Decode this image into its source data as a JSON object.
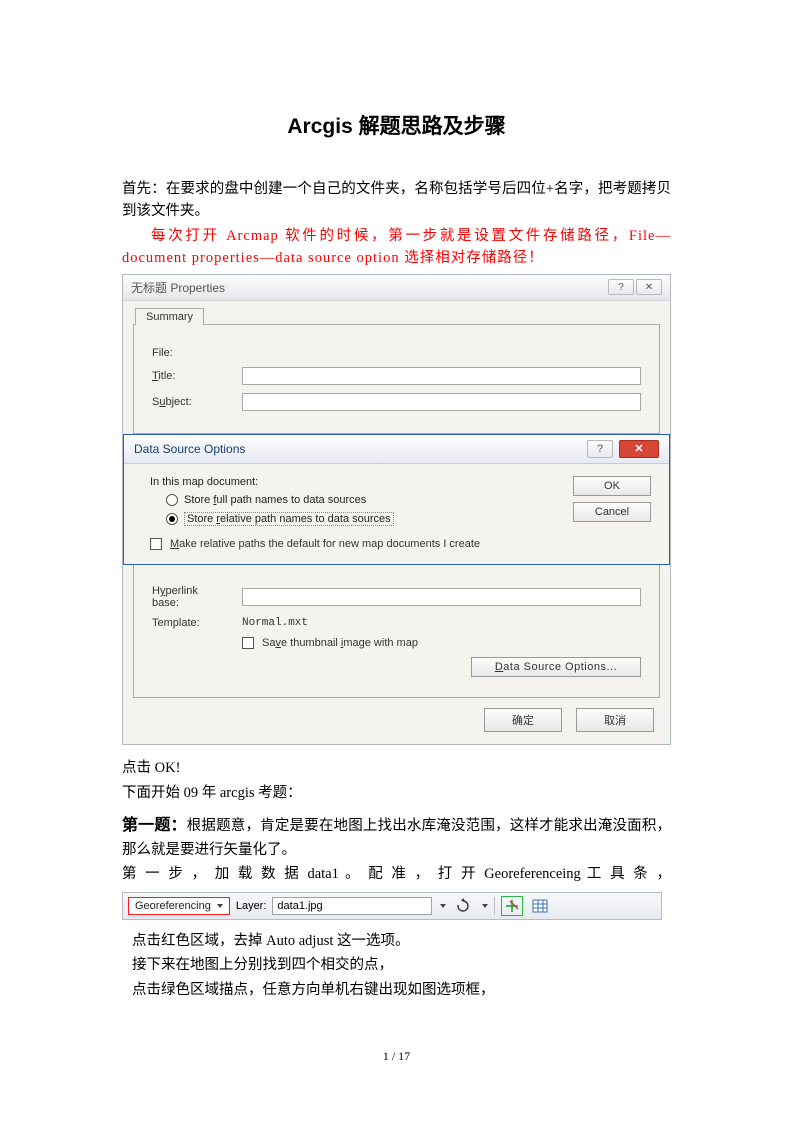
{
  "doc": {
    "title": "Arcgis  解题思路及步骤",
    "para1": "首先：在要求的盘中创建一个自己的文件夹，名称包括学号后四位+名字，把考题拷贝到该文件夹。",
    "para2_red": "每次打开 Arcmap 软件的时候，第一步就是设置文件存储路径，File—document properties—data source option  选择相对存储路径！",
    "after_dlg_1": "点击 OK!",
    "after_dlg_2": "下面开始 09 年 arcgis 考题：",
    "q1_head": "第一题：",
    "q1_body1": "根据题意，肯定是要在地图上找出水库淹没范围，这样才能求出淹没面积，那么就是要进行矢量化了。",
    "q1_step1": "第 一 步 ， 加 载 数 据 data1 。 配 准 ， 打 开 Georeferenceing 工 具 条 ，",
    "note1": "点击红色区域，去掉 Auto adjust 这一选项。",
    "note2": "接下来在地图上分别找到四个相交的点，",
    "note3": "点击绿色区域描点，任意方向单机右键出现如图选项框，",
    "page_footer": "1  /  17"
  },
  "dlg1": {
    "title": "无标题 Properties",
    "tab": "Summary",
    "file_label": "File:",
    "title_label": "Title:",
    "subject_label": "Subject:",
    "hyperlink_label": "Hyperlink base:",
    "template_label": "Template:",
    "template_value": "Normal.mxt",
    "save_thumb": "Save thumbnail image with map",
    "dso_button": "Data Source Options...",
    "ok": "确定",
    "cancel": "取消"
  },
  "dlg2": {
    "title": "Data Source Options",
    "group_label": "In this map document:",
    "opt_full": "Store full path names to data sources",
    "opt_rel": "Store relative path names to data sources",
    "make_default": "Make relative paths the default for new map documents I create",
    "ok": "OK",
    "cancel": "Cancel"
  },
  "toolbar": {
    "main": "Georeferencing",
    "layer_label": "Layer:",
    "layer_value": "data1.jpg"
  }
}
